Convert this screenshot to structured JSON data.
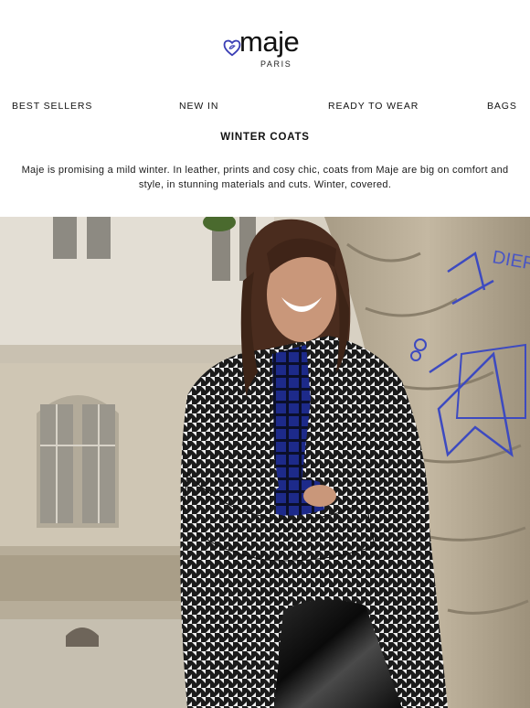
{
  "brand": {
    "name": "maje",
    "tagline": "PARIS",
    "accent_color": "#3b3fb5"
  },
  "nav": {
    "items": [
      {
        "label": "BEST SELLERS"
      },
      {
        "label": "NEW IN"
      },
      {
        "label": "READY TO WEAR"
      },
      {
        "label": "BAGS"
      }
    ]
  },
  "section": {
    "title": "WINTER COATS",
    "intro": "Maje is promising a mild winter. In leather, prints and cosy chic, coats from Maje are big on comfort and style, in stunning materials and cuts. Winter, covered."
  },
  "hero": {
    "icon": "hero-photo",
    "graffiti_text": "DIER"
  }
}
